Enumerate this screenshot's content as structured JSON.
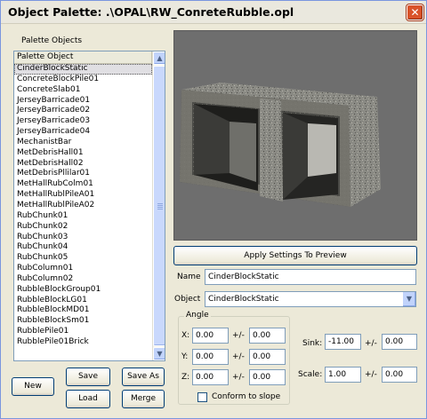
{
  "window": {
    "title": "Object Palette: .\\OPAL\\RW_ConreteRubble.opl",
    "close_glyph": "✕"
  },
  "palette": {
    "section_label": "Palette Objects",
    "column_header": "Palette Object",
    "items": [
      "CinderBlockStatic",
      "ConcreteBlockPile01",
      "ConcreteSlab01",
      "JerseyBarricade01",
      "JerseyBarricade02",
      "JerseyBarricade03",
      "JerseyBarricade04",
      "MechanistBar",
      "MetDebrisHall01",
      "MetDebrisHall02",
      "MetDebrisPllilar01",
      "MetHallRubColm01",
      "MetHallRublPileA01",
      "MetHallRublPileA02",
      "RubChunk01",
      "RubChunk02",
      "RubChunk03",
      "RubChunk04",
      "RubChunk05",
      "RubColumn01",
      "RubColumn02",
      "RubbleBlockGroup01",
      "RubbleBlockLG01",
      "RubbleBlockMD01",
      "RubbleBlockSm01",
      "RubblePile01",
      "RubblePile01Brick"
    ],
    "selected_index": 0
  },
  "buttons": {
    "new": "New",
    "save": "Save",
    "save_as": "Save As",
    "load": "Load",
    "merge": "Merge",
    "apply": "Apply Settings To Preview"
  },
  "form": {
    "name_label": "Name",
    "name_value": "CinderBlockStatic",
    "object_label": "Object",
    "object_value": "CinderBlockStatic",
    "angle_label": "Angle",
    "x_label": "X:",
    "y_label": "Y:",
    "z_label": "Z:",
    "pm_label": "+/-",
    "x_value": "0.00",
    "x_pm": "0.00",
    "y_value": "0.00",
    "y_pm": "0.00",
    "z_value": "0.00",
    "z_pm": "0.00",
    "sink_label": "Sink:",
    "sink_value": "-11.00",
    "sink_pm": "0.00",
    "scale_label": "Scale:",
    "scale_value": "1.00",
    "scale_pm": "0.00",
    "conform_label": "Conform to slope",
    "conform_checked": false
  },
  "icons": {
    "scroll_up": "chevron-up-icon",
    "scroll_down": "chevron-down-icon",
    "dropdown": "chevron-down-icon"
  },
  "colors": {
    "window_bg": "#ece9d8",
    "preview_bg": "#6e6e6e",
    "close_button": "#d9532a"
  }
}
